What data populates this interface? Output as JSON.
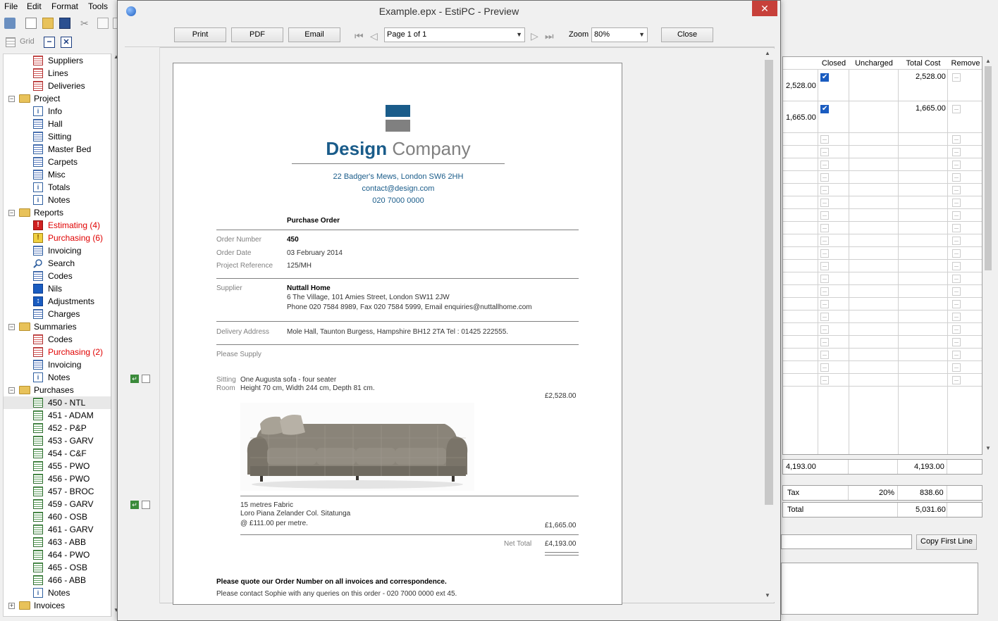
{
  "menubar": {
    "items": [
      "File",
      "Edit",
      "Format",
      "Tools"
    ]
  },
  "grid_toolbar": {
    "grid_label": "Grid"
  },
  "tree": [
    {
      "label": "Suppliers",
      "icon": "red-grid",
      "indent": 1
    },
    {
      "label": "Lines",
      "icon": "red-grid",
      "indent": 1
    },
    {
      "label": "Deliveries",
      "icon": "red-grid",
      "indent": 1
    },
    {
      "label": "Project",
      "icon": "folder",
      "indent": 0,
      "expander": "−"
    },
    {
      "label": "Info",
      "icon": "info",
      "indent": 1
    },
    {
      "label": "Hall",
      "icon": "blue-grid",
      "indent": 1
    },
    {
      "label": "Sitting",
      "icon": "blue-grid",
      "indent": 1
    },
    {
      "label": "Master Bed",
      "icon": "blue-grid",
      "indent": 1
    },
    {
      "label": "Carpets",
      "icon": "blue-grid",
      "indent": 1
    },
    {
      "label": "Misc",
      "icon": "blue-grid",
      "indent": 1
    },
    {
      "label": "Totals",
      "icon": "info",
      "indent": 1
    },
    {
      "label": "Notes",
      "icon": "info",
      "indent": 1
    },
    {
      "label": "Reports",
      "icon": "folder",
      "indent": 0,
      "expander": "−"
    },
    {
      "label": "Estimating (4)",
      "icon": "warn-r",
      "indent": 1,
      "red": true
    },
    {
      "label": "Purchasing (6)",
      "icon": "warn-y",
      "indent": 1,
      "red": true
    },
    {
      "label": "Invoicing",
      "icon": "blue-grid",
      "indent": 1
    },
    {
      "label": "Search",
      "icon": "search",
      "indent": 1
    },
    {
      "label": "Codes",
      "icon": "blue-grid",
      "indent": 1
    },
    {
      "label": "Nils",
      "icon": "nils",
      "indent": 1
    },
    {
      "label": "Adjustments",
      "icon": "adj",
      "indent": 1
    },
    {
      "label": "Charges",
      "icon": "blue-grid",
      "indent": 1
    },
    {
      "label": "Summaries",
      "icon": "folder",
      "indent": 0,
      "expander": "−"
    },
    {
      "label": "Codes",
      "icon": "red-grid",
      "indent": 1
    },
    {
      "label": "Purchasing (2)",
      "icon": "red-grid",
      "indent": 1,
      "red": true
    },
    {
      "label": "Invoicing",
      "icon": "blue-grid",
      "indent": 1
    },
    {
      "label": "Notes",
      "icon": "info",
      "indent": 1
    },
    {
      "label": "Purchases",
      "icon": "folder",
      "indent": 0,
      "expander": "−"
    },
    {
      "label": "450 - NTL",
      "icon": "green-grid",
      "indent": 1,
      "selected": true
    },
    {
      "label": "451 - ADAM",
      "icon": "green-grid",
      "indent": 1
    },
    {
      "label": "452 - P&P",
      "icon": "green-grid",
      "indent": 1
    },
    {
      "label": "453 - GARV",
      "icon": "green-grid",
      "indent": 1
    },
    {
      "label": "454 - C&F",
      "icon": "green-grid",
      "indent": 1
    },
    {
      "label": "455 - PWO",
      "icon": "green-grid",
      "indent": 1
    },
    {
      "label": "456 - PWO",
      "icon": "green-grid",
      "indent": 1
    },
    {
      "label": "457 - BROC",
      "icon": "green-grid",
      "indent": 1
    },
    {
      "label": "459 - GARV",
      "icon": "green-grid",
      "indent": 1
    },
    {
      "label": "460 - OSB",
      "icon": "green-grid",
      "indent": 1
    },
    {
      "label": "461 - GARV",
      "icon": "green-grid",
      "indent": 1
    },
    {
      "label": "463 - ABB",
      "icon": "green-grid",
      "indent": 1
    },
    {
      "label": "464 - PWO",
      "icon": "green-grid",
      "indent": 1
    },
    {
      "label": "465 - OSB",
      "icon": "green-grid",
      "indent": 1
    },
    {
      "label": "466 - ABB",
      "icon": "green-grid",
      "indent": 1
    },
    {
      "label": "Notes",
      "icon": "info",
      "indent": 1
    },
    {
      "label": "Invoices",
      "icon": "folder",
      "indent": 0,
      "expander": "+"
    }
  ],
  "grid": {
    "headers": {
      "closed": "Closed",
      "uncharged": "Uncharged",
      "total_cost": "Total Cost",
      "remove": "Remove"
    },
    "rows": [
      {
        "amount": "2,528.00",
        "closed": true,
        "total": "2,528.00"
      },
      {
        "amount": "1,665.00",
        "closed": true,
        "total": "1,665.00"
      }
    ],
    "empty_rows": 20,
    "totals": {
      "amount": "4,193.00",
      "total": "4,193.00"
    },
    "tax": {
      "label": "Tax",
      "rate": "20%",
      "value": "838.60"
    },
    "grand_total": {
      "label": "Total",
      "value": "5,031.60"
    },
    "copy_button": "Copy First Line"
  },
  "preview": {
    "title": "Example.epx - EstiPC - Preview",
    "buttons": {
      "print": "Print",
      "pdf": "PDF",
      "email": "Email",
      "close": "Close"
    },
    "page_select": "Page 1 of 1",
    "zoom_label": "Zoom",
    "zoom_value": "80%"
  },
  "document": {
    "company_bold": "Design",
    "company_rest": "Company",
    "address": "22 Badger's Mews, London SW6 2HH",
    "email": "contact@design.com",
    "phone": "020 7000 0000",
    "doc_title": "Purchase Order",
    "order_number_label": "Order Number",
    "order_number": "450",
    "order_date_label": "Order Date",
    "order_date": "03 February 2014",
    "project_ref_label": "Project Reference",
    "project_ref": "125/MH",
    "supplier_label": "Supplier",
    "supplier_name": "Nuttall Home",
    "supplier_address": "6 The Village, 101 Amies Street, London SW11 2JW",
    "supplier_contact": "Phone 020 7584 8989, Fax 020 7584 5999, Email enquiries@nuttallhome.com",
    "delivery_label": "Delivery Address",
    "delivery_address": "Mole Hall, Taunton Burgess, Hampshire BH12 2TA Tel : 01425 222555.",
    "please_supply": "Please Supply",
    "item1_room_a": "Sitting",
    "item1_room_b": "Room",
    "item1_line1": "One Augusta  sofa - four seater",
    "item1_line2": "Height 70 cm, Width 244 cm, Depth 81 cm.",
    "item1_price": "£2,528.00",
    "item2_line1": "15 metres Fabric",
    "item2_line2": "Loro Piana Zelander Col. Sitatunga",
    "item2_line3": "@ £111.00 per metre.",
    "item2_price": "£1,665.00",
    "net_total_label": "Net Total",
    "net_total": "£4,193.00",
    "footer_bold": "Please quote our Order Number on all invoices and correspondence.",
    "footer_text": "Please contact Sophie with any queries on this order -  020 7000 0000 ext 45."
  },
  "colors": {
    "brand_blue": "#1a5c8a",
    "brand_grey": "#808080",
    "title_close": "#c7403a"
  }
}
